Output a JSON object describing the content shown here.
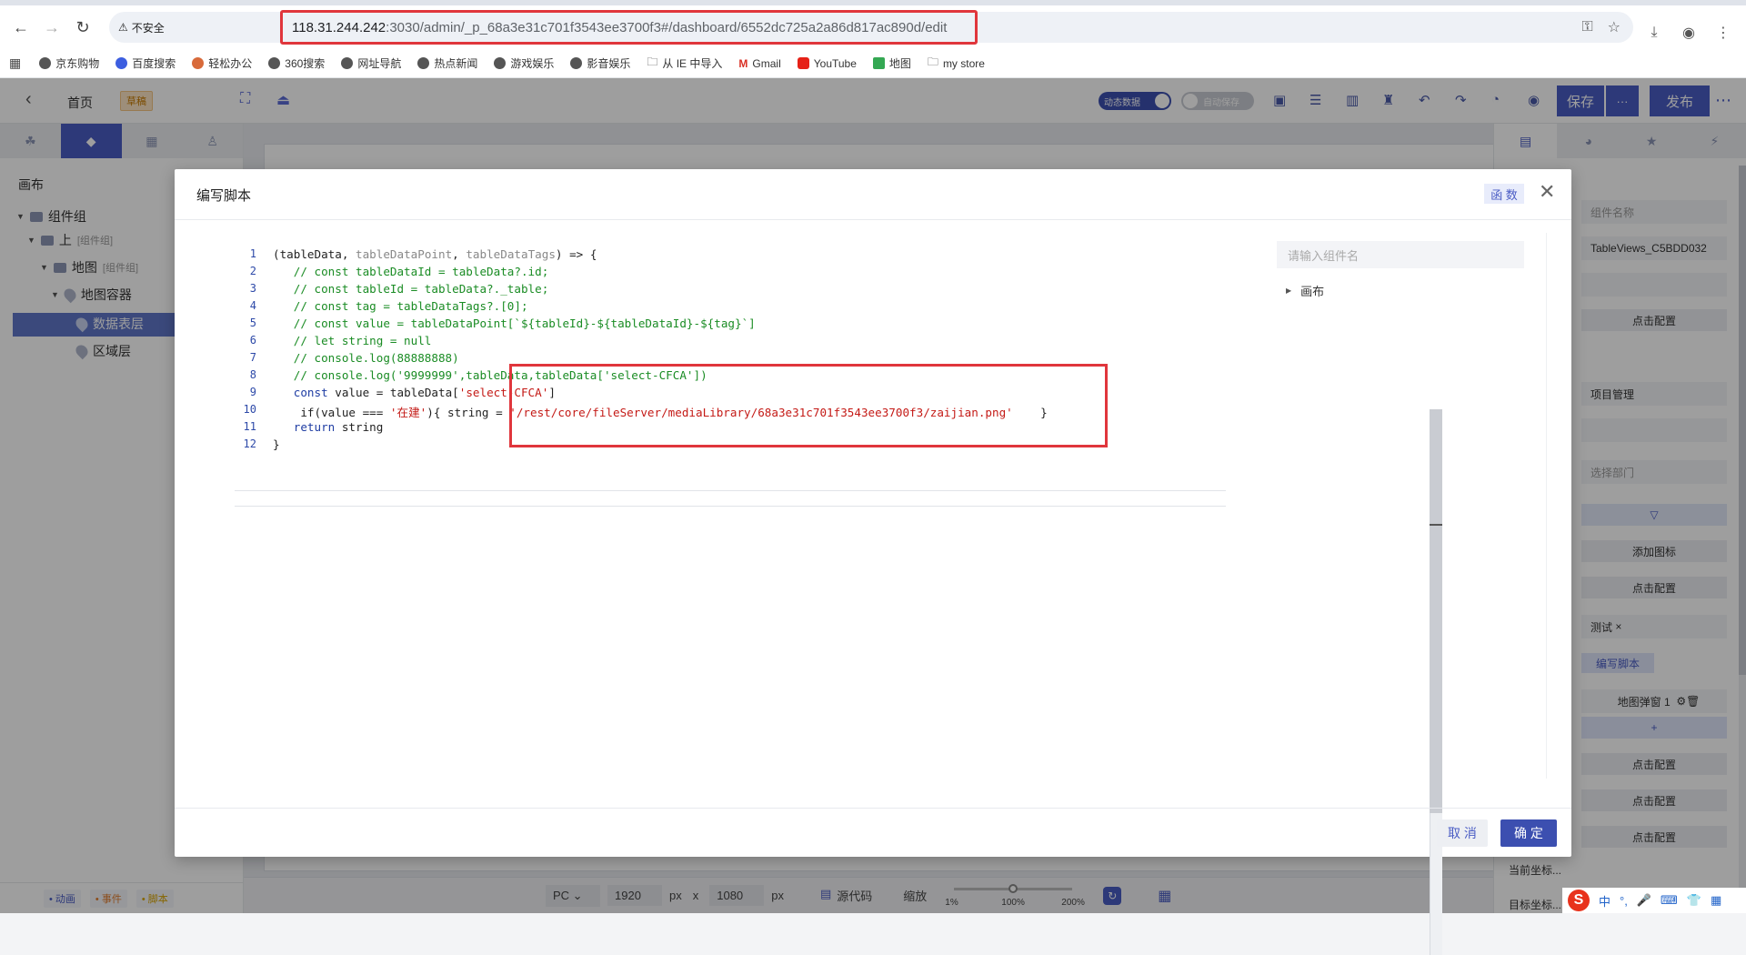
{
  "browser": {
    "insecure_label": "不安全",
    "url_host": "118.31.244.242",
    "url_path": ":3030/admin/_p_68a3e31c701f3543ee3700f3#/dashboard/6552dc725a2a86d817ac890d/edit",
    "bookmarks": [
      "京东购物",
      "百度搜索",
      "轻松办公",
      "360搜索",
      "网址导航",
      "热点新闻",
      "游戏娱乐",
      "影音娱乐",
      "从 IE 中导入",
      "Gmail",
      "YouTube",
      "地图",
      "my store"
    ]
  },
  "header": {
    "home": "首页",
    "draft_badge": "草稿",
    "dynamic_data": "动态数据",
    "auto_save": "自动保存",
    "save": "保存",
    "save_more": "···",
    "publish": "发布"
  },
  "left_panel": {
    "canvas_label": "画布",
    "tree": [
      {
        "label": "组件组",
        "tag": ""
      },
      {
        "label": "上",
        "tag": "[组件组]"
      },
      {
        "label": "地图",
        "tag": "[组件组]"
      },
      {
        "label": "地图容器",
        "tag": ""
      },
      {
        "label": "数据表层",
        "tag": ""
      },
      {
        "label": "区域层",
        "tag": ""
      }
    ],
    "bottom": [
      "• 动画",
      "• 事件",
      "• 脚本"
    ]
  },
  "bottom_bar": {
    "device": "PC",
    "width": "1920",
    "px1": "px",
    "x": "x",
    "height": "1080",
    "px2": "px",
    "source": "源代码",
    "zoom": "缩放",
    "zoom_min": "1%",
    "zoom_mid": "100%",
    "zoom_max": "200%"
  },
  "right_panel": {
    "component_name_placeholder": "组件名称",
    "component_id": "TableViews_C5BDD032",
    "click_config": "点击配置",
    "project_mgmt": "项目管理",
    "select_dept": "选择部门",
    "add_icon": "添加图标",
    "test_tag": "测试",
    "write_script": "编写脚本",
    "map_popup": "地图弹窗 1",
    "plus": "+",
    "current_coord": "当前坐标...",
    "target_coord": "目标坐标..."
  },
  "modal": {
    "title": "编写脚本",
    "fn_button": "函 数",
    "search_placeholder": "请输入组件名",
    "tree_root": "画布",
    "cancel": "取 消",
    "confirm": "确 定",
    "code_lines": [
      "(tableData, tableDataPoint, tableDataTags) => {",
      "   // const tableDataId = tableData?.id;",
      "   // const tableId = tableData?._table;",
      "   // const tag = tableDataTags?.[0];",
      "   // const value = tableDataPoint[`${tableId}-${tableDataId}-${tag}`]",
      "   // let string = null",
      "   // console.log(88888888)",
      "   // console.log('9999999',tableData,tableData['select-CFCA'])",
      "   const value = tableData['select-CFCA']",
      "    if(value === '在建'){ string = '/rest/core/fileServer/mediaLibrary/68a3e31c701f3543ee3700f3/zaijian.png'    }",
      "   return string",
      "}"
    ]
  },
  "ime": {
    "lang": "中"
  }
}
